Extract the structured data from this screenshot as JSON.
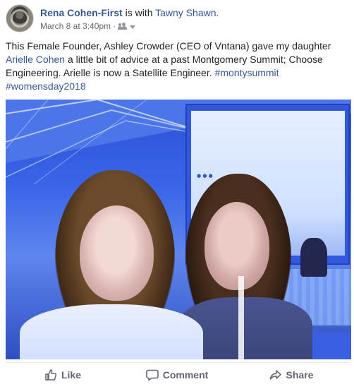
{
  "post": {
    "author": "Rena Cohen-First",
    "with_text": "is with",
    "tagged": "Tawny Shawn.",
    "timestamp": "March 8 at 3:40pm",
    "dot": "·",
    "text_part1": "This Female Founder, Ashley Crowder (CEO of Vntana) gave my daughter",
    "mention": "Arielle Cohen",
    "text_part2": "a little bit of advice at a past Montgomery Summit; Choose Engineering. Arielle is now a Satellite Engineer.",
    "hashtag1": "#montysummit",
    "hashtag2": "#womensday2018"
  },
  "actions": [
    {
      "label": "Like",
      "icon": "thumbs-up-icon"
    },
    {
      "label": "Comment",
      "icon": "comment-icon"
    },
    {
      "label": "Share",
      "icon": "share-icon"
    }
  ],
  "colors": {
    "link": "#365899",
    "meta": "#616770",
    "text": "#1d2129"
  }
}
